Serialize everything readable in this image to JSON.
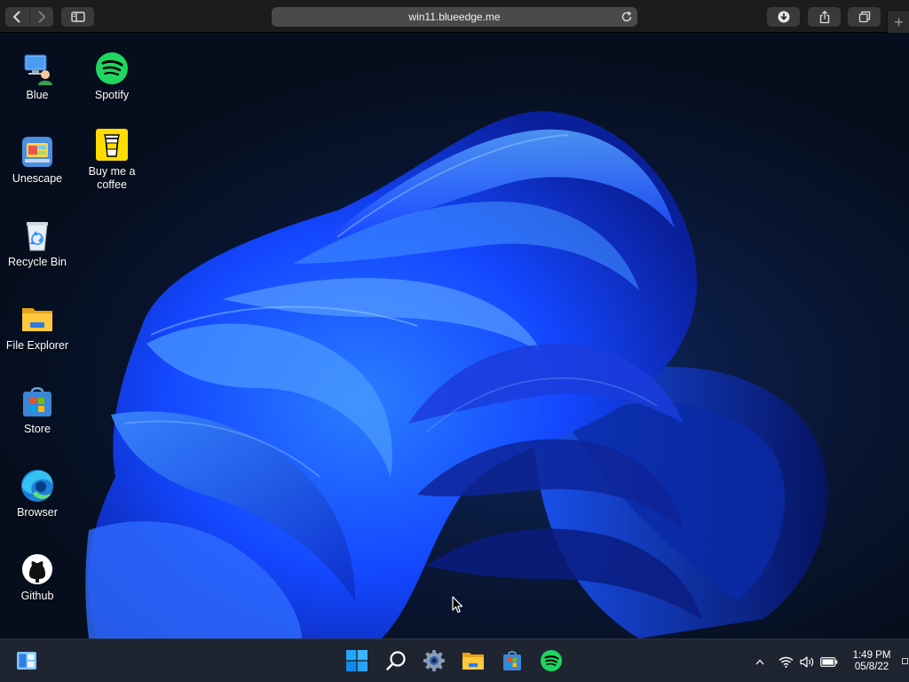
{
  "browser": {
    "url": "win11.blueedge.me",
    "icons": [
      "back-arrow-icon",
      "forward-arrow-icon",
      "sidebar-icon",
      "reload-icon",
      "download-icon",
      "share-icon",
      "tabs-icon",
      "plus-icon"
    ],
    "new_tab_glyph": "+"
  },
  "desktop": {
    "icons": [
      {
        "label": "Blue",
        "icon": "user-computer-icon"
      },
      {
        "label": "Spotify",
        "icon": "spotify-icon"
      },
      {
        "label": "Unescape",
        "icon": "unescape-icon"
      },
      {
        "label": "Buy me a coffee",
        "icon": "coffee-cup-icon"
      },
      {
        "label": "Recycle Bin",
        "icon": "recycle-bin-icon"
      },
      {
        "label": "File Explorer",
        "icon": "folder-icon"
      },
      {
        "label": "Store",
        "icon": "store-icon"
      },
      {
        "label": "Browser",
        "icon": "edge-icon"
      },
      {
        "label": "Github",
        "icon": "github-icon"
      }
    ]
  },
  "taskbar": {
    "left_icon": "widgets-icon",
    "center_icons": [
      "windows-start-icon",
      "search-icon",
      "settings-gear-icon",
      "file-explorer-icon",
      "store-icon",
      "spotify-icon"
    ],
    "tray_icons": [
      "chevron-up-icon",
      "wifi-icon",
      "volume-icon",
      "battery-icon"
    ],
    "clock": {
      "time": "1:49 PM",
      "date": "05/8/22"
    }
  },
  "colors": {
    "accent": "#1f5bff",
    "taskbar_bg": "#1f2530",
    "chrome_bg": "#1c1c1e",
    "spotify_green": "#1ed760"
  }
}
